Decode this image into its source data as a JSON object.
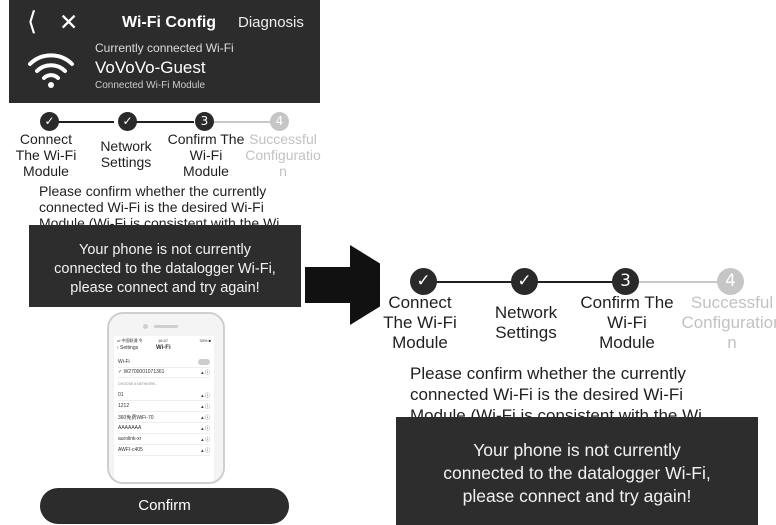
{
  "header": {
    "back_icon": "chevron-left-icon",
    "close_icon": "close-icon",
    "title": "Wi-Fi Config",
    "diagnosis": "Diagnosis",
    "wifi_icon": "wifi-icon",
    "connected_label": "Currently connected Wi-Fi",
    "ssid": "VoVoVo-Guest",
    "module_label": "Connected Wi-Fi Module"
  },
  "steps": [
    {
      "marker": "✓",
      "label": "Connect The Wi-Fi Module",
      "lines": [
        "Connect",
        "The Wi-Fi",
        "Module"
      ],
      "status": "done"
    },
    {
      "marker": "✓",
      "label": "Network Settings",
      "lines": [
        "Network",
        "Settings"
      ],
      "status": "done"
    },
    {
      "marker": "3",
      "label": "Confirm The Wi-Fi Module",
      "lines": [
        "Confirm The",
        "Wi-Fi",
        "Module"
      ],
      "status": "current"
    },
    {
      "marker": "4",
      "label": "Successful Configuration",
      "lines_left": [
        "Successful",
        "Configuratio",
        "n"
      ],
      "lines_right": [
        "Successful",
        "Configuration",
        "n"
      ],
      "status": "pending"
    }
  ],
  "description": {
    "line1": "Please confirm whether the currently",
    "line2": "connected Wi-Fi is the desired Wi-Fi",
    "line3": "Module (Wi-Fi is consistent with the Wi"
  },
  "toast": {
    "line1": "Your phone is not currently",
    "line2": "connected to the datalogger Wi-Fi,",
    "line3": "please connect and try again!"
  },
  "phone_illustration": {
    "status_left": "•ıl 中国联通 令",
    "status_time": "16:47",
    "status_right": "33% ■",
    "back": "‹ Settings",
    "title": "Wi-Fi",
    "wifi_label": "Wi-Fi",
    "connected_network": "✓ W2700001071361",
    "choose_label": "CHOOSE A NETWORK...",
    "networks": [
      "01",
      "1212",
      "360免费WiFi-70",
      "AAAAAAA",
      "aurolink-xr",
      "AWFI-c405"
    ]
  },
  "confirm_button": "Confirm",
  "arrow_icon": "arrow-right-icon",
  "colors": {
    "dark": "#2c2c2c",
    "inactive": "#c6c6c6",
    "toast": "#2d2d2d"
  }
}
